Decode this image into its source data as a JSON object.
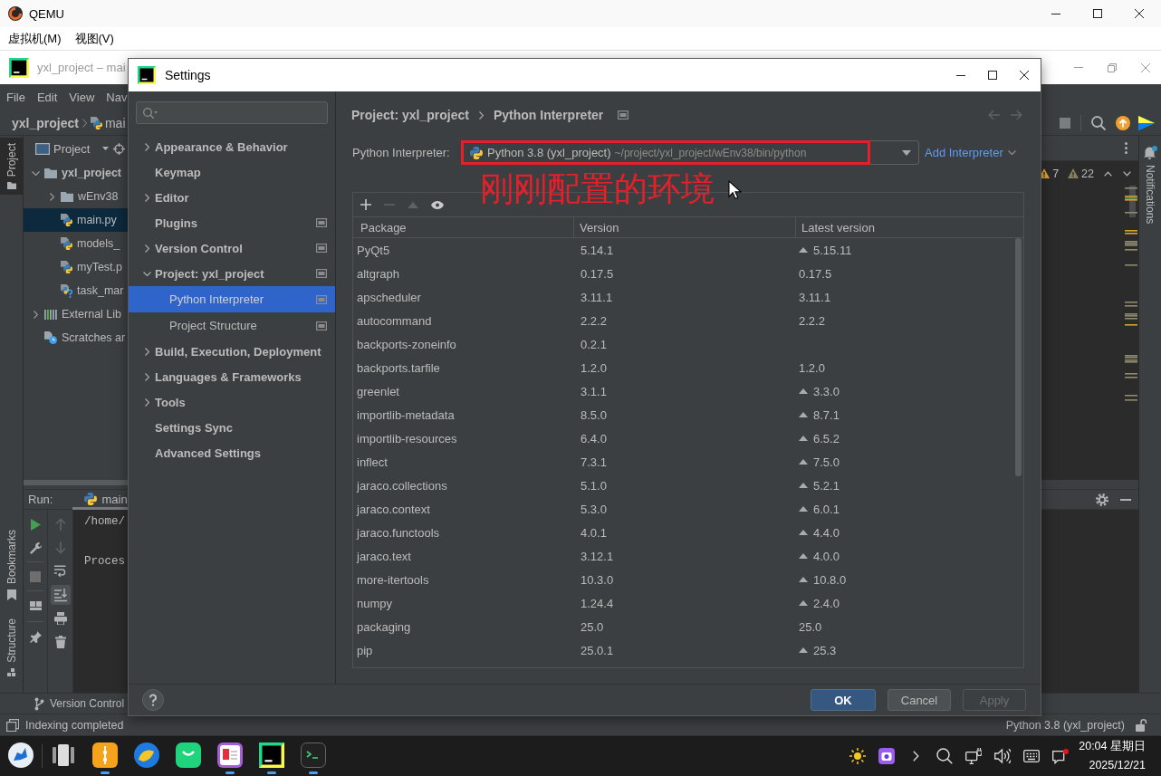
{
  "qemu": {
    "title": "QEMU",
    "menu": [
      "虚拟机(M)",
      "视图(V)"
    ]
  },
  "ide": {
    "title": "yxl_project – mai",
    "menu": [
      "File",
      "Edit",
      "View",
      "Nav"
    ],
    "breadcrumbs": [
      "yxl_project",
      "mai"
    ],
    "left_tabs": [
      {
        "label": "Project",
        "kind": "project",
        "selected": true
      },
      {
        "label": "Bookmarks",
        "kind": "bookmarks",
        "selected": false
      },
      {
        "label": "Structure",
        "kind": "structure",
        "selected": false
      }
    ],
    "project_panel": {
      "title": "Project",
      "tree": [
        {
          "label": "yxl_project",
          "kind": "module",
          "expanded": true,
          "selected": false,
          "children": [
            {
              "label": "wEnv38",
              "kind": "folder",
              "expanded": false,
              "selected": false
            },
            {
              "label": "main.py",
              "kind": "python",
              "selected": true
            },
            {
              "label": "models_",
              "kind": "python",
              "selected": false
            },
            {
              "label": "myTest.p",
              "kind": "python",
              "selected": false
            },
            {
              "label": "task_mar",
              "kind": "unknown",
              "selected": false
            }
          ]
        },
        {
          "label": "External Lib",
          "kind": "library",
          "expanded": false,
          "selected": false
        },
        {
          "label": "Scratches ar",
          "kind": "scratches",
          "selected": false
        }
      ]
    },
    "inspections": [
      {
        "kind": "warning",
        "count": "7"
      },
      {
        "kind": "weak_warning",
        "count": "22"
      }
    ],
    "notifications_tab": {
      "label": "Notifications",
      "unread": true
    },
    "run_panel": {
      "label": "Run:",
      "tab": "main",
      "scroll_to_end": true,
      "console": [
        "/home/",
        "Proces"
      ]
    },
    "bottom_tabs": [
      "Version Control"
    ],
    "status_bar": {
      "message": "Indexing completed",
      "interpreter": "Python 3.8 (yxl_project)"
    }
  },
  "settings": {
    "title": "Settings",
    "nav": [
      {
        "label": "Appearance & Behavior",
        "expanded": false,
        "project_scoped": false,
        "selected": false
      },
      {
        "label": "Keymap",
        "project_scoped": false,
        "selected": false
      },
      {
        "label": "Editor",
        "expanded": false,
        "project_scoped": false,
        "selected": false
      },
      {
        "label": "Plugins",
        "project_scoped": true,
        "selected": false
      },
      {
        "label": "Version Control",
        "expanded": false,
        "project_scoped": true,
        "selected": false
      },
      {
        "label": "Project: yxl_project",
        "expanded": true,
        "project_scoped": true,
        "selected": false,
        "children": [
          {
            "label": "Python Interpreter",
            "project_scoped": true,
            "selected": true
          },
          {
            "label": "Project Structure",
            "project_scoped": true,
            "selected": false
          }
        ]
      },
      {
        "label": "Build, Execution, Deployment",
        "expanded": false,
        "project_scoped": false,
        "selected": false
      },
      {
        "label": "Languages & Frameworks",
        "expanded": false,
        "project_scoped": false,
        "selected": false
      },
      {
        "label": "Tools",
        "expanded": false,
        "project_scoped": false,
        "selected": false
      },
      {
        "label": "Settings Sync",
        "project_scoped": false,
        "selected": false
      },
      {
        "label": "Advanced Settings",
        "project_scoped": false,
        "selected": false
      }
    ],
    "breadcrumbs": [
      "Project: yxl_project",
      "Python Interpreter"
    ],
    "interpreter": {
      "label": "Python Interpreter:",
      "value": "Python 3.8 (yxl_project)",
      "path": "~/project/yxl_project/wEnv38/bin/python"
    },
    "add_interpreter": "Add Interpreter",
    "annotation": "刚刚配置的环境",
    "package_tools": [
      {
        "kind": "add",
        "disabled": false
      },
      {
        "kind": "remove",
        "disabled": true
      },
      {
        "kind": "upgrade",
        "disabled": true
      },
      {
        "kind": "show_early_releases",
        "disabled": false
      }
    ],
    "packages": {
      "columns": [
        "Package",
        "Version",
        "Latest version"
      ],
      "rows": [
        {
          "package": "PyQt5",
          "version": "5.14.1",
          "latest": "5.15.11",
          "upgrade": true
        },
        {
          "package": "altgraph",
          "version": "0.17.5",
          "latest": "0.17.5",
          "upgrade": false
        },
        {
          "package": "apscheduler",
          "version": "3.11.1",
          "latest": "3.11.1",
          "upgrade": false
        },
        {
          "package": "autocommand",
          "version": "2.2.2",
          "latest": "2.2.2",
          "upgrade": false
        },
        {
          "package": "backports-zoneinfo",
          "version": "0.2.1",
          "upgrade": false
        },
        {
          "package": "backports.tarfile",
          "version": "1.2.0",
          "latest": "1.2.0",
          "upgrade": false
        },
        {
          "package": "greenlet",
          "version": "3.1.1",
          "latest": "3.3.0",
          "upgrade": true
        },
        {
          "package": "importlib-metadata",
          "version": "8.5.0",
          "latest": "8.7.1",
          "upgrade": true
        },
        {
          "package": "importlib-resources",
          "version": "6.4.0",
          "latest": "6.5.2",
          "upgrade": true
        },
        {
          "package": "inflect",
          "version": "7.3.1",
          "latest": "7.5.0",
          "upgrade": true
        },
        {
          "package": "jaraco.collections",
          "version": "5.1.0",
          "latest": "5.2.1",
          "upgrade": true
        },
        {
          "package": "jaraco.context",
          "version": "5.3.0",
          "latest": "6.0.1",
          "upgrade": true
        },
        {
          "package": "jaraco.functools",
          "version": "4.0.1",
          "latest": "4.4.0",
          "upgrade": true
        },
        {
          "package": "jaraco.text",
          "version": "3.12.1",
          "latest": "4.0.0",
          "upgrade": true
        },
        {
          "package": "more-itertools",
          "version": "10.3.0",
          "latest": "10.8.0",
          "upgrade": true
        },
        {
          "package": "numpy",
          "version": "1.24.4",
          "latest": "2.4.0",
          "upgrade": true
        },
        {
          "package": "packaging",
          "version": "25.0",
          "latest": "25.0",
          "upgrade": false
        },
        {
          "package": "pip",
          "version": "25.0.1",
          "latest": "25.3",
          "upgrade": true
        }
      ]
    },
    "buttons": [
      {
        "label": "OK",
        "kind": "primary",
        "disabled": false
      },
      {
        "label": "Cancel",
        "kind": "secondary",
        "disabled": false
      },
      {
        "label": "Apply",
        "kind": "secondary",
        "disabled": true
      }
    ]
  },
  "taskbar": {
    "apps": [
      {
        "kind": "files",
        "running": true
      },
      {
        "kind": "browser",
        "running": false
      },
      {
        "kind": "chat",
        "running": false
      },
      {
        "kind": "text_editor",
        "running": true
      },
      {
        "kind": "pycharm",
        "running": true
      },
      {
        "kind": "terminal",
        "running": true
      }
    ],
    "clock": {
      "time": "20:04 星期日",
      "date": "2025/12/21"
    },
    "unread_notifications": true
  }
}
